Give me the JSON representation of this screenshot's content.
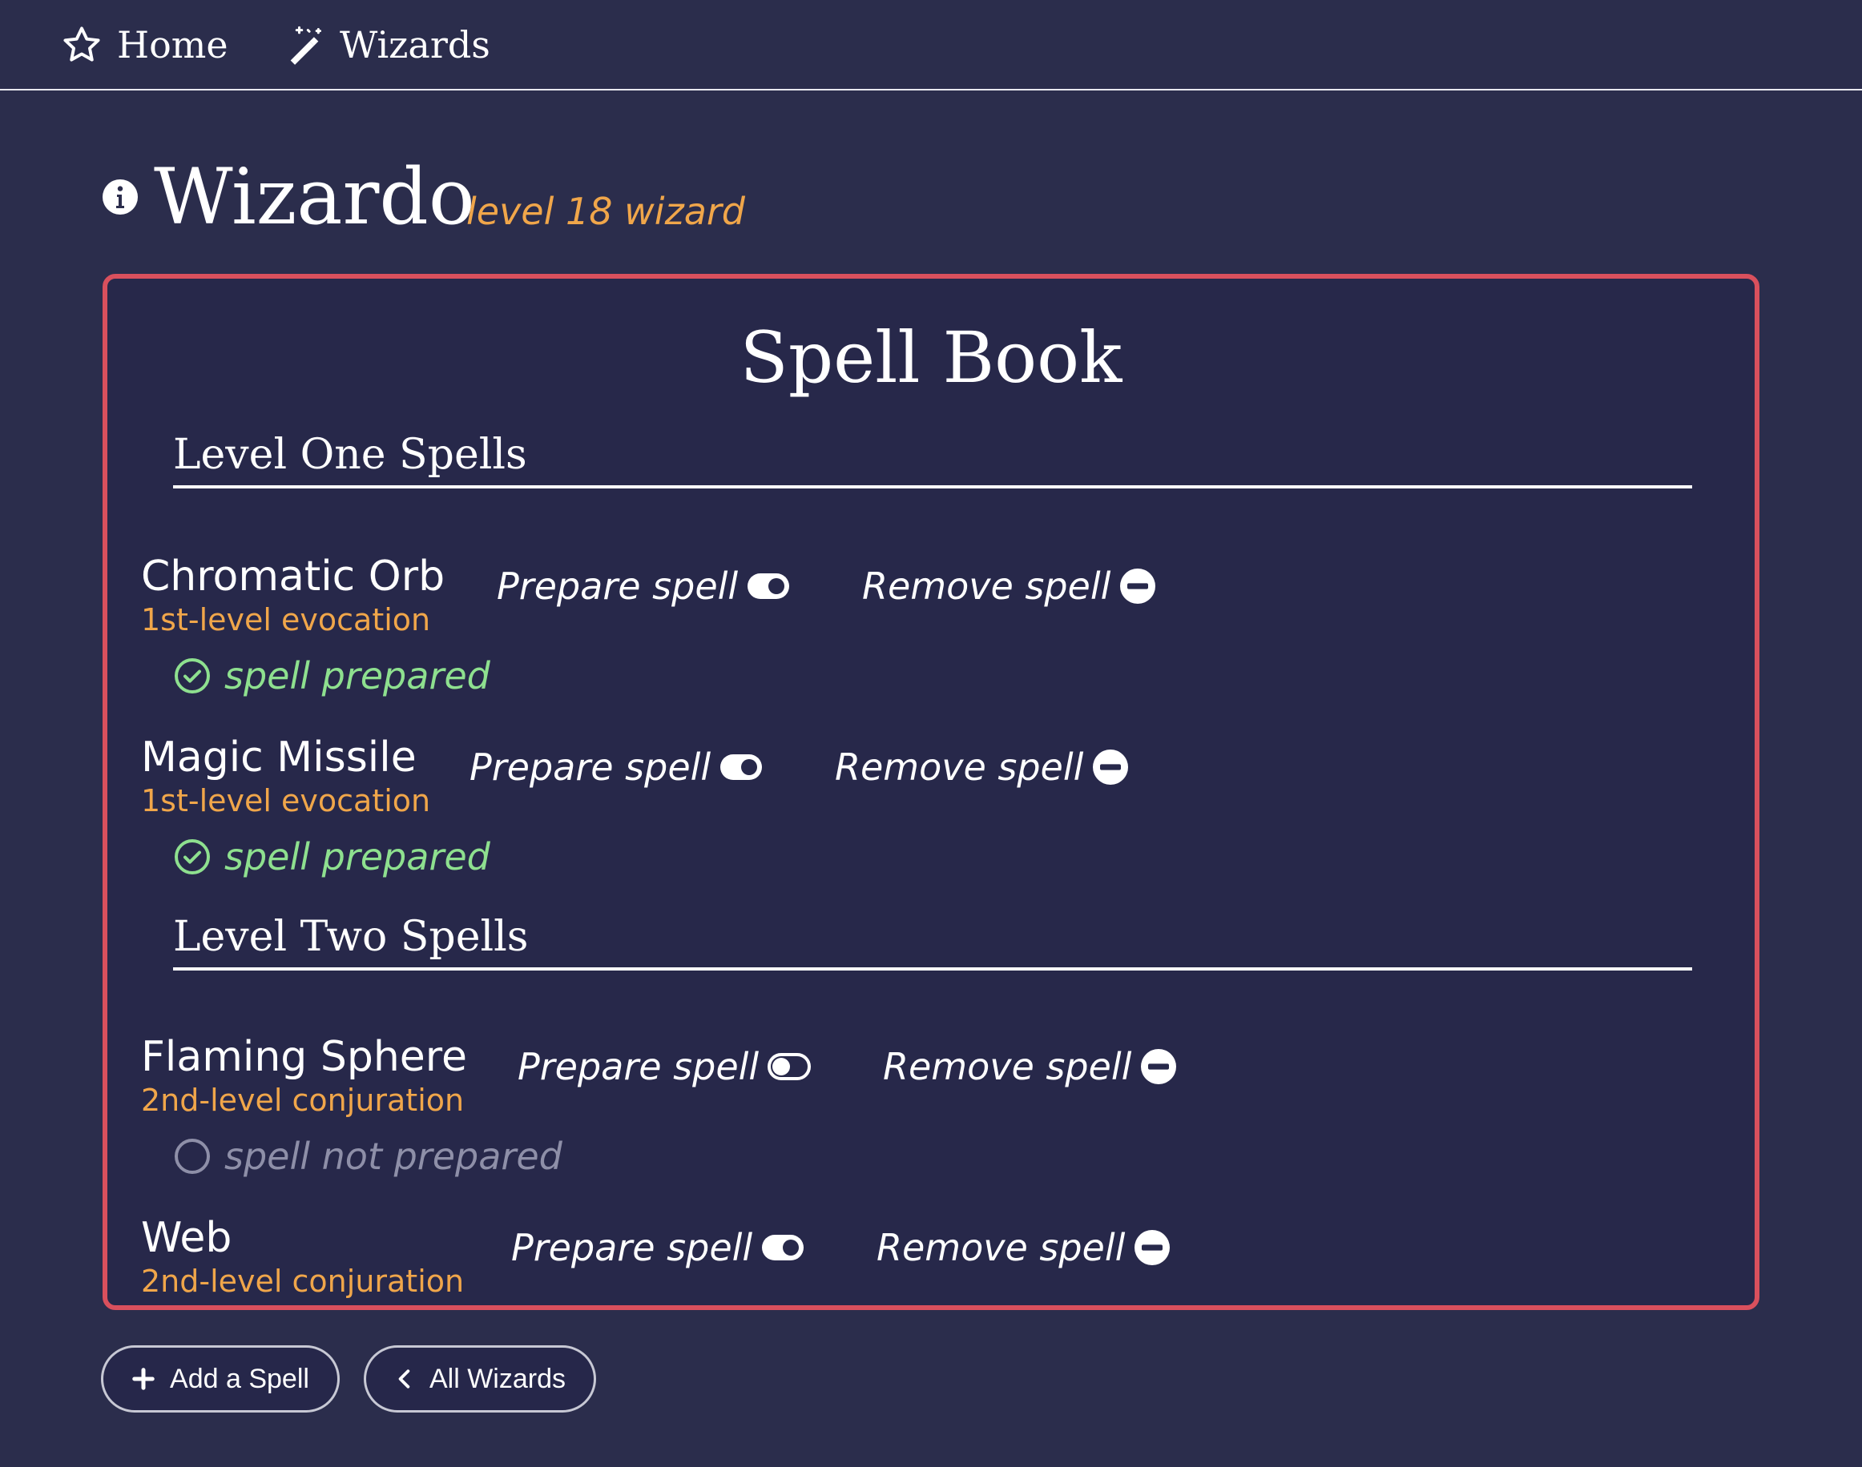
{
  "nav": {
    "home_label": "Home",
    "wizards_label": "Wizards"
  },
  "wizard": {
    "name": "Wizardo",
    "subtitle": "level 18 wizard"
  },
  "spellbook": {
    "title": "Spell Book",
    "levels": [
      {
        "heading": "Level One Spells",
        "spells": [
          {
            "name": "Chromatic Orb",
            "type": "1st-level evocation",
            "prepare_label": "Prepare spell",
            "remove_label": "Remove spell",
            "status": "spell prepared",
            "prepared": true
          },
          {
            "name": "Magic Missile",
            "type": "1st-level evocation",
            "prepare_label": "Prepare spell",
            "remove_label": "Remove spell",
            "status": "spell prepared",
            "prepared": true
          }
        ]
      },
      {
        "heading": "Level Two Spells",
        "spells": [
          {
            "name": "Flaming Sphere",
            "type": "2nd-level conjuration",
            "prepare_label": "Prepare spell",
            "remove_label": "Remove spell",
            "status": "spell not prepared",
            "prepared": false
          },
          {
            "name": "Web",
            "type": "2nd-level conjuration",
            "prepare_label": "Prepare spell",
            "remove_label": "Remove spell",
            "status": "",
            "prepared": true
          }
        ]
      }
    ]
  },
  "buttons": {
    "add_spell": "Add a Spell",
    "all_wizards": "All Wizards"
  },
  "icons": {
    "home": "star-icon",
    "wizards": "magic-wand-icon",
    "info": "info-circle-icon",
    "toggle": "toggle-icon",
    "remove": "minus-circle-icon",
    "prepared": "check-circle-icon",
    "unprepared": "empty-circle-icon",
    "add": "plus-icon",
    "back": "chevron-left-icon"
  },
  "colors": {
    "background": "#2b2d4c",
    "panel": "#27284a",
    "panel_border": "#d9505d",
    "accent": "#f0a64a",
    "prepared": "#8ee08f",
    "unprepared": "#8e8fa8"
  }
}
